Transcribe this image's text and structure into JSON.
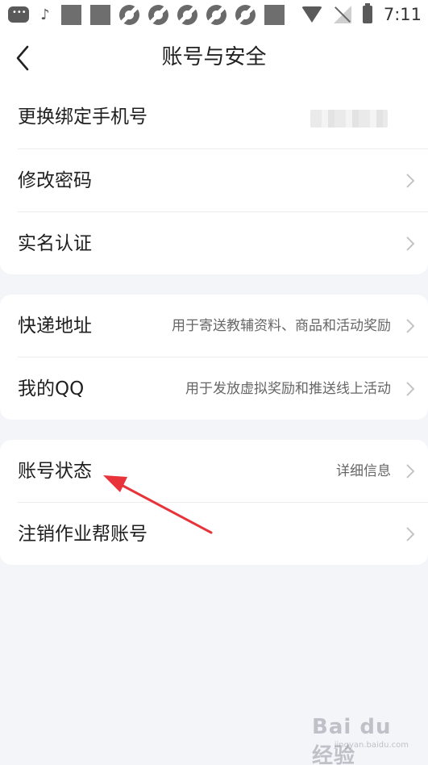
{
  "status_bar": {
    "time": "7:11",
    "icons_left": [
      "message-bubble-icon",
      "tiktok-icon",
      "app-square-icon",
      "app-square-icon",
      "spinner-icon",
      "spinner-icon",
      "spinner-icon",
      "spinner-icon",
      "spinner-icon",
      "app-square-icon"
    ],
    "icons_right": [
      "wifi-icon",
      "no-signal-icon",
      "battery-icon"
    ]
  },
  "header": {
    "title": "账号与安全",
    "back_icon": "chevron-left-icon"
  },
  "groups": [
    {
      "items": [
        {
          "label": "更换绑定手机号",
          "value_blurred": true
        },
        {
          "label": "修改密码",
          "desc": ""
        },
        {
          "label": "实名认证",
          "desc": ""
        }
      ]
    },
    {
      "items": [
        {
          "label": "快递地址",
          "desc": "用于寄送教辅资料、商品和活动奖励"
        },
        {
          "label": "我的QQ",
          "desc": "用于发放虚拟奖励和推送线上活动"
        }
      ]
    },
    {
      "items": [
        {
          "label": "账号状态",
          "desc": "详细信息"
        },
        {
          "label": "注销作业帮账号",
          "desc": ""
        }
      ]
    }
  ],
  "colors": {
    "background": "#f4f5f9",
    "card": "#ffffff",
    "text_primary": "#1f1f1f",
    "text_secondary": "#666666",
    "chevron": "#c4c4c4",
    "annotation_arrow": "#e8333a"
  },
  "watermark": {
    "text": "Bai du 经验",
    "sub": "jingyan.baidu.com"
  }
}
